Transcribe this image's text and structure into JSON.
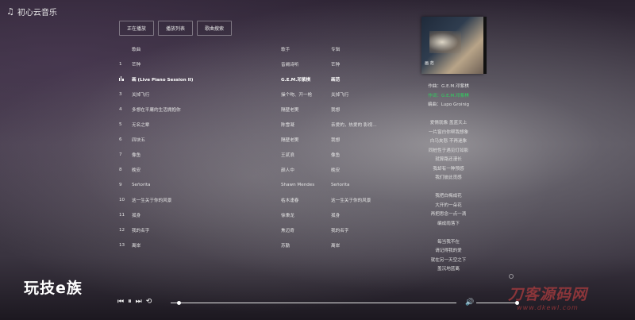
{
  "app": {
    "title": "初心云音乐",
    "logo_icon": "music-note-icon"
  },
  "tabs": [
    {
      "label": "正在播放"
    },
    {
      "label": "播放列表"
    },
    {
      "label": "歌曲搜索"
    }
  ],
  "list": {
    "headers": {
      "song": "歌曲",
      "artist": "歌手",
      "album": "专辑"
    },
    "rows": [
      {
        "num": "1",
        "song": "芒种",
        "artist": "音阙诗听",
        "album": "芒种",
        "playing": false
      },
      {
        "num": "",
        "song": "画 (Live Piano Session II)",
        "artist": "G.E.M.邓紫棋",
        "album": "画范",
        "playing": true
      },
      {
        "num": "3",
        "song": "关掉飞行",
        "artist": "操个吻、开一枪",
        "album": "关掉飞行",
        "playing": false
      },
      {
        "num": "4",
        "song": "多想在平庸的生活拥抱你",
        "artist": "隔壁老樊",
        "album": "我想",
        "playing": false
      },
      {
        "num": "5",
        "song": "无名之辈",
        "artist": "陈雪凝",
        "album": "亲爱的，热爱的 影视…",
        "playing": false
      },
      {
        "num": "6",
        "song": "四块五",
        "artist": "隔壁老樊",
        "album": "我想",
        "playing": false
      },
      {
        "num": "7",
        "song": "像鱼",
        "artist": "王贰浪",
        "album": "像鱼",
        "playing": false
      },
      {
        "num": "8",
        "song": "晚安",
        "artist": "颜人中",
        "album": "晚安",
        "playing": false
      },
      {
        "num": "9",
        "song": "Señorita",
        "artist": "Shawn Mendes",
        "album": "Señorita",
        "playing": false
      },
      {
        "num": "10",
        "song": "这一生关于你的风景",
        "artist": "枯木逢春",
        "album": "这一生关于你的风景",
        "playing": false
      },
      {
        "num": "11",
        "song": "孤身",
        "artist": "徐秉龙",
        "album": "孤身",
        "playing": false
      },
      {
        "num": "12",
        "song": "我的名字",
        "artist": "焦迈奇",
        "album": "我的名字",
        "playing": false
      },
      {
        "num": "13",
        "song": "离岸",
        "artist": "苏勤",
        "album": "离岸",
        "playing": false
      }
    ]
  },
  "cover": {
    "text": "画 范"
  },
  "lyrics": [
    {
      "text": "作曲：G.E.M.邓紫棋",
      "active": false
    },
    {
      "text": "作词：G.E.M.邓紫棋",
      "active": true
    },
    {
      "text": "编曲：Lupo Groinig",
      "active": false
    },
    {
      "text": "",
      "active": false
    },
    {
      "text": "爱情就像 盖蓝天上",
      "active": false
    },
    {
      "text": "一片窗白你帮我想象",
      "active": false
    },
    {
      "text": "白马夹怒 不再迷象",
      "active": false
    },
    {
      "text": "同桩性于遇见灯如影",
      "active": false
    },
    {
      "text": "就算路还漫长",
      "active": false
    },
    {
      "text": "我却有一种预感",
      "active": false
    },
    {
      "text": "我们彼此觅感",
      "active": false
    },
    {
      "text": "",
      "active": false
    },
    {
      "text": "我把白梅成花",
      "active": false
    },
    {
      "text": "大开的一朵花",
      "active": false
    },
    {
      "text": "再把思念一点一滴",
      "active": false
    },
    {
      "text": "编成雨落下",
      "active": false
    },
    {
      "text": "",
      "active": false
    },
    {
      "text": "每当我不在",
      "active": false
    },
    {
      "text": "请记得我的爱",
      "active": false
    },
    {
      "text": "就在另一天空之下",
      "active": false
    },
    {
      "text": "盖沉地蓝离",
      "active": false
    }
  ],
  "watermarks": {
    "left": "玩技e族",
    "right_main": "刀客源码网",
    "right_url": "www.dkewl.com"
  },
  "player": {
    "progress": 0.01,
    "volume": 1.0
  }
}
